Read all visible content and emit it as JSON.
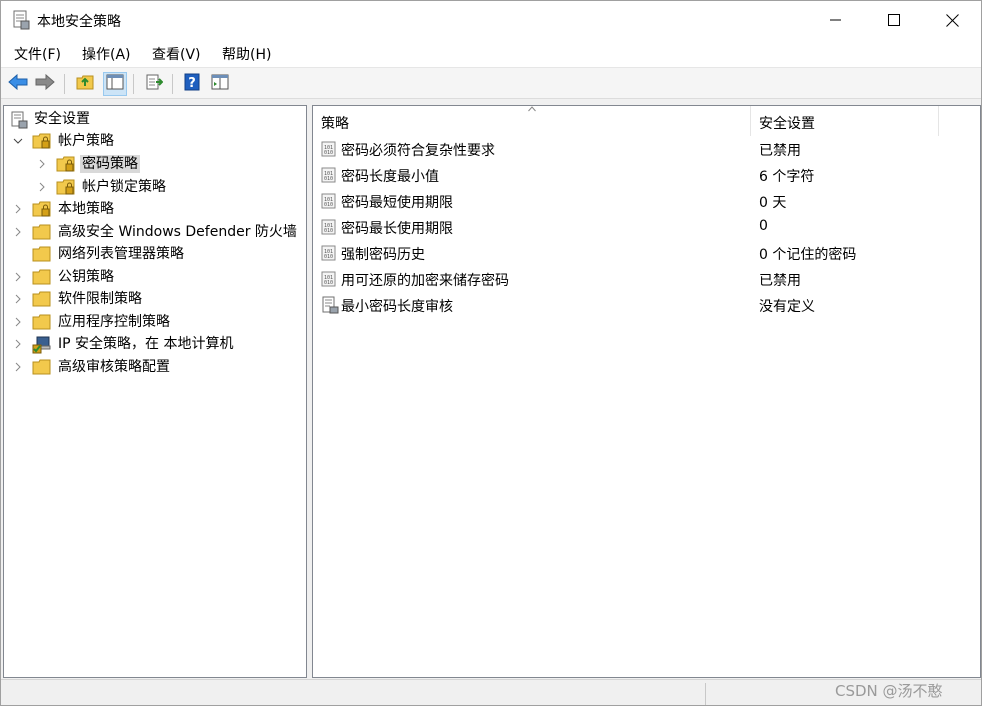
{
  "window": {
    "title": "本地安全策略",
    "controls": {
      "minimize_icon": "minimize-icon",
      "maximize_icon": "maximize-icon",
      "close_icon": "close-icon"
    }
  },
  "menubar": {
    "items": [
      {
        "label": "文件(F)"
      },
      {
        "label": "操作(A)"
      },
      {
        "label": "查看(V)"
      },
      {
        "label": "帮助(H)"
      }
    ]
  },
  "toolbar": {
    "buttons": [
      "back-arrow-icon",
      "forward-arrow-icon",
      "up-folder-icon",
      "show-hide-tree-icon",
      "export-list-icon",
      "help-icon",
      "properties-icon"
    ]
  },
  "tree": {
    "root": {
      "label": "安全设置"
    },
    "items": [
      {
        "label": "帐户策略",
        "level": 1,
        "expanded": true
      },
      {
        "label": "密码策略",
        "level": 2,
        "selected": true
      },
      {
        "label": "帐户锁定策略",
        "level": 2
      },
      {
        "label": "本地策略",
        "level": 1
      },
      {
        "label": "高级安全 Windows Defender 防火墙",
        "level": 1
      },
      {
        "label": "网络列表管理器策略",
        "level": 1
      },
      {
        "label": "公钥策略",
        "level": 1
      },
      {
        "label": "软件限制策略",
        "level": 1
      },
      {
        "label": "应用程序控制策略",
        "level": 1
      },
      {
        "label": "IP 安全策略，在 本地计算机",
        "level": 1
      },
      {
        "label": "高级审核策略配置",
        "level": 1
      }
    ]
  },
  "list": {
    "columns": {
      "policy": "策略",
      "setting": "安全设置"
    },
    "rows": [
      {
        "policy": "密码必须符合复杂性要求",
        "setting": "已禁用"
      },
      {
        "policy": "密码长度最小值",
        "setting": "6 个字符"
      },
      {
        "policy": "密码最短使用期限",
        "setting": "0 天"
      },
      {
        "policy": "密码最长使用期限",
        "setting": "0"
      },
      {
        "policy": "强制密码历史",
        "setting": "0 个记住的密码"
      },
      {
        "policy": "用可还原的加密来储存密码",
        "setting": "已禁用"
      },
      {
        "policy": "最小密码长度审核",
        "setting": "没有定义"
      }
    ]
  },
  "watermark": "CSDN @汤不憨",
  "colors": {
    "selected_bg": "#d9d9d9",
    "active_tool_bg": "#cce4f7",
    "folder_yellow": "#f2c94c",
    "help_blue": "#1f5fbf"
  }
}
